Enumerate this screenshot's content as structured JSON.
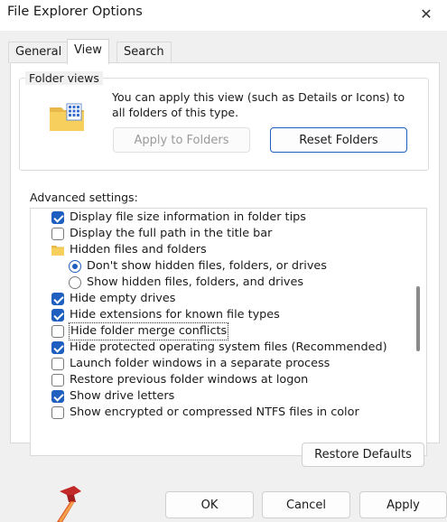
{
  "window": {
    "title": "File Explorer Options",
    "close_glyph": "✕"
  },
  "tabs": [
    {
      "label": "General"
    },
    {
      "label": "View",
      "active": true
    },
    {
      "label": "Search"
    }
  ],
  "folder_views": {
    "legend": "Folder views",
    "description": "You can apply this view (such as Details or Icons) to all folders of this type.",
    "apply_label": "Apply to Folders",
    "reset_label": "Reset Folders"
  },
  "advanced": {
    "label": "Advanced settings:",
    "items": [
      {
        "type": "checkbox",
        "label": "Display file size information in folder tips",
        "checked": true
      },
      {
        "type": "checkbox",
        "label": "Display the full path in the title bar",
        "checked": false
      },
      {
        "type": "folder",
        "label": "Hidden files and folders"
      },
      {
        "type": "radio",
        "label": "Don't show hidden files, folders, or drives",
        "selected": true
      },
      {
        "type": "radio",
        "label": "Show hidden files, folders, and drives",
        "selected": false
      },
      {
        "type": "checkbox",
        "label": "Hide empty drives",
        "checked": true
      },
      {
        "type": "checkbox",
        "label": "Hide extensions for known file types",
        "checked": true
      },
      {
        "type": "checkbox",
        "label": "Hide folder merge conflicts",
        "checked": false,
        "focused": true
      },
      {
        "type": "checkbox",
        "label": "Hide protected operating system files (Recommended)",
        "checked": true
      },
      {
        "type": "checkbox",
        "label": "Launch folder windows in a separate process",
        "checked": false
      },
      {
        "type": "checkbox",
        "label": "Restore previous folder windows at logon",
        "checked": false
      },
      {
        "type": "checkbox",
        "label": "Show drive letters",
        "checked": true
      },
      {
        "type": "checkbox",
        "label": "Show encrypted or compressed NTFS files in color",
        "checked": false
      }
    ]
  },
  "buttons": {
    "restore_defaults": "Restore Defaults",
    "ok": "OK",
    "cancel": "Cancel",
    "apply": "Apply"
  },
  "colors": {
    "accent": "#1f5fbf",
    "dialog_bg": "#f0f0f0"
  }
}
